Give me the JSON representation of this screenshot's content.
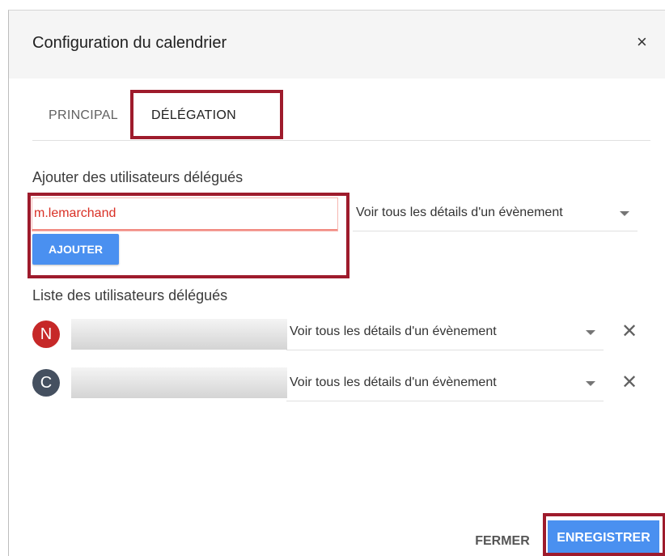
{
  "dialog": {
    "title": "Configuration du calendrier",
    "close_icon": "close-icon"
  },
  "tabs": [
    {
      "label": "PRINCIPAL",
      "active": false
    },
    {
      "label": "DÉLÉGATION",
      "active": true
    }
  ],
  "add_section": {
    "title": "Ajouter des utilisateurs délégués",
    "email_value": "m.lemarchand",
    "permission": "Voir tous les détails d'un évènement",
    "add_button": "AJOUTER"
  },
  "list_section": {
    "title": "Liste des utilisateurs délégués",
    "users": [
      {
        "initial": "N",
        "avatar_color": "#c62828",
        "permission": "Voir tous les détails d'un évènement"
      },
      {
        "initial": "C",
        "avatar_color": "#455060",
        "permission": "Voir tous les détails d'un évènement"
      }
    ]
  },
  "footer": {
    "close_button": "FERMER",
    "save_button": "ENREGISTRER"
  },
  "colors": {
    "accent": "#4a90f0",
    "highlight": "#9e1b2c",
    "error": "#d93025"
  }
}
